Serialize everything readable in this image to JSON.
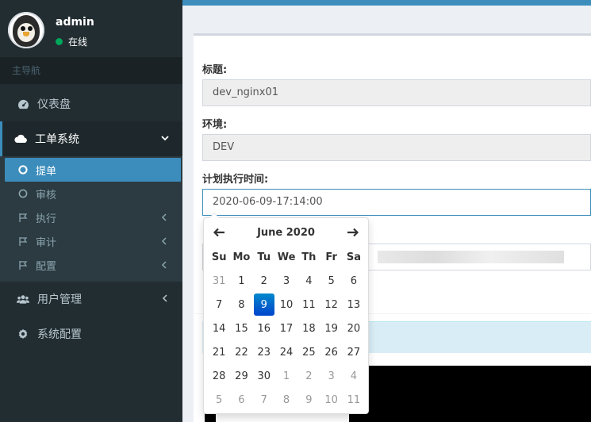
{
  "user": {
    "name": "admin",
    "status": "在线"
  },
  "sidebar": {
    "header": "主导航",
    "items": [
      {
        "label": "仪表盘",
        "icon": "dashboard-icon"
      },
      {
        "label": "工单系统",
        "icon": "cloud-icon",
        "expanded": true
      },
      {
        "label": "用户管理",
        "icon": "users-icon"
      },
      {
        "label": "系统配置",
        "icon": "gear-icon"
      }
    ],
    "submenu": [
      {
        "label": "提单",
        "icon": "circle-outline-icon",
        "selected": true
      },
      {
        "label": "审核",
        "icon": "circle-outline-icon"
      },
      {
        "label": "执行",
        "icon": "flag-icon"
      },
      {
        "label": "审计",
        "icon": "flag-icon"
      },
      {
        "label": "配置",
        "icon": "flag-icon"
      }
    ]
  },
  "form": {
    "title_label": "标题:",
    "title_value": "dev_nginx01",
    "env_label": "环境:",
    "env_value": "DEV",
    "time_label": "计划执行时间:",
    "time_value": "2020-06-09-17:14:00"
  },
  "datepicker": {
    "month_title": "June 2020",
    "weekdays": [
      "Su",
      "Mo",
      "Tu",
      "We",
      "Th",
      "Fr",
      "Sa"
    ],
    "weeks": [
      [
        "31",
        "1",
        "2",
        "3",
        "4",
        "5",
        "6"
      ],
      [
        "7",
        "8",
        "9",
        "10",
        "11",
        "12",
        "13"
      ],
      [
        "14",
        "15",
        "16",
        "17",
        "18",
        "19",
        "20"
      ],
      [
        "21",
        "22",
        "23",
        "24",
        "25",
        "26",
        "27"
      ],
      [
        "28",
        "29",
        "30",
        "1",
        "2",
        "3",
        "4"
      ],
      [
        "5",
        "6",
        "7",
        "8",
        "9",
        "10",
        "11"
      ]
    ],
    "selected_day": "9"
  },
  "colors": {
    "sidebar_bg": "#222d32",
    "accent": "#3c8dbc",
    "selected_day": "#0066cc",
    "online": "#00a65a"
  }
}
